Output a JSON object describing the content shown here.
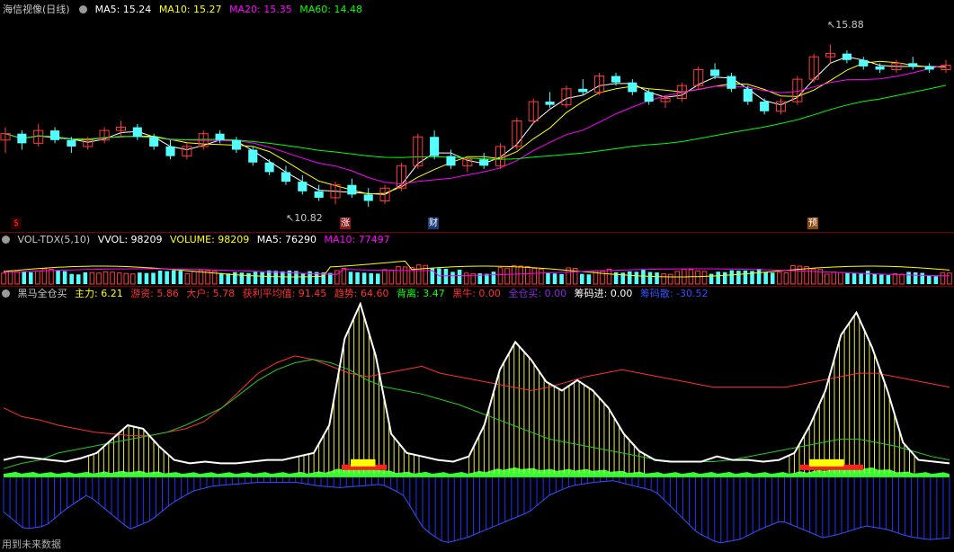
{
  "main": {
    "title": "海信视像(日线)",
    "ma": [
      {
        "label": "MA5: 15.24",
        "color": "#ffffff"
      },
      {
        "label": "MA10: 15.27",
        "color": "#ffff00"
      },
      {
        "label": "MA20: 15.35",
        "color": "#ff00ff"
      },
      {
        "label": "MA60: 14.48",
        "color": "#00ff00"
      }
    ],
    "high_label": "15.88",
    "low_label": "10.82",
    "markers": [
      {
        "text": "$",
        "color": "#ff3030",
        "bg": "#2a0000"
      },
      {
        "text": "涨",
        "color": "#ffffff",
        "bg": "#8a1a1a"
      },
      {
        "text": "财",
        "color": "#ffffff",
        "bg": "#1a3a7a"
      },
      {
        "text": "预",
        "color": "#ffffff",
        "bg": "#8a4a10"
      }
    ]
  },
  "vol": {
    "title": "VOL-TDX(5,10)",
    "items": [
      {
        "label": "VVOL: 98209",
        "color": "#ffffff"
      },
      {
        "label": "VOLUME: 98209",
        "color": "#ffff00"
      },
      {
        "label": "MA5: 76290",
        "color": "#ffffff"
      },
      {
        "label": "MA10: 77497",
        "color": "#ff00ff"
      }
    ]
  },
  "ind": {
    "title": "黑马全仓买",
    "items": [
      {
        "label": "主力: 6.21",
        "color": "#ffff00"
      },
      {
        "label": "游资: 5.86",
        "color": "#ff3030"
      },
      {
        "label": "大户: 5.78",
        "color": "#ff3030"
      },
      {
        "label": "获利平均值: 91.45",
        "color": "#ff3030"
      },
      {
        "label": "趋势: 64.60",
        "color": "#ff3030"
      },
      {
        "label": "背离: 3.47",
        "color": "#00ff00"
      },
      {
        "label": "黑牛: 0.00",
        "color": "#ff3030"
      },
      {
        "label": "全仓买: 0.00",
        "color": "#8a2be2"
      },
      {
        "label": "筹码进: 0.00",
        "color": "#ffffff"
      },
      {
        "label": "筹码散: -30.52",
        "color": "#3050ff"
      }
    ]
  },
  "footer": "用到未来数据",
  "chart_data": [
    {
      "type": "candlestick",
      "title": "海信视像(日线)",
      "series": [
        {
          "name": "MA5",
          "value": 15.24
        },
        {
          "name": "MA10",
          "value": 15.27
        },
        {
          "name": "MA20",
          "value": 15.35
        },
        {
          "name": "MA60",
          "value": 14.48
        }
      ],
      "annotations": [
        {
          "text": "15.88",
          "kind": "high"
        },
        {
          "text": "10.82",
          "kind": "low"
        }
      ],
      "ylim": [
        10.2,
        16.6
      ],
      "ohlc_sample": [
        [
          12.9,
          13.3,
          12.5,
          13.1
        ],
        [
          13.1,
          13.2,
          12.6,
          12.8
        ],
        [
          12.8,
          13.4,
          12.7,
          13.2
        ],
        [
          13.2,
          13.3,
          12.8,
          12.9
        ],
        [
          12.9,
          13.0,
          12.5,
          12.7
        ],
        [
          12.7,
          13.0,
          12.6,
          12.9
        ],
        [
          12.9,
          13.3,
          12.8,
          13.2
        ],
        [
          13.2,
          13.5,
          13.0,
          13.3
        ],
        [
          13.3,
          13.4,
          12.9,
          13.0
        ],
        [
          13.0,
          13.1,
          12.6,
          12.7
        ],
        [
          12.7,
          12.9,
          12.3,
          12.4
        ],
        [
          12.4,
          12.8,
          12.3,
          12.7
        ],
        [
          12.7,
          13.2,
          12.6,
          13.1
        ],
        [
          13.1,
          13.2,
          12.8,
          12.9
        ],
        [
          12.9,
          13.0,
          12.5,
          12.6
        ],
        [
          12.6,
          12.7,
          12.1,
          12.2
        ],
        [
          12.2,
          12.3,
          11.8,
          11.9
        ],
        [
          11.9,
          12.1,
          11.5,
          11.6
        ],
        [
          11.6,
          11.8,
          11.2,
          11.3
        ],
        [
          11.3,
          11.5,
          11.0,
          11.1
        ],
        [
          11.1,
          11.6,
          10.9,
          11.5
        ],
        [
          11.5,
          11.7,
          11.1,
          11.2
        ],
        [
          11.2,
          11.4,
          10.82,
          11.0
        ],
        [
          11.0,
          11.5,
          10.9,
          11.4
        ],
        [
          11.4,
          12.2,
          11.3,
          12.1
        ],
        [
          12.1,
          13.1,
          12.0,
          13.0
        ],
        [
          13.0,
          13.2,
          12.3,
          12.4
        ],
        [
          12.4,
          12.6,
          12.0,
          12.1
        ],
        [
          12.1,
          12.4,
          11.9,
          12.3
        ],
        [
          12.3,
          12.5,
          12.0,
          12.1
        ],
        [
          12.1,
          12.8,
          12.0,
          12.7
        ],
        [
          12.7,
          13.6,
          12.6,
          13.5
        ],
        [
          13.5,
          14.2,
          13.4,
          14.1
        ],
        [
          14.1,
          14.4,
          13.9,
          14.0
        ],
        [
          14.0,
          14.6,
          13.9,
          14.5
        ],
        [
          14.5,
          14.8,
          14.3,
          14.4
        ],
        [
          14.4,
          15.0,
          14.3,
          14.9
        ],
        [
          14.9,
          15.0,
          14.6,
          14.7
        ],
        [
          14.7,
          14.8,
          14.3,
          14.4
        ],
        [
          14.4,
          14.5,
          14.0,
          14.1
        ],
        [
          14.1,
          14.3,
          13.9,
          14.2
        ],
        [
          14.2,
          14.7,
          14.1,
          14.6
        ],
        [
          14.6,
          15.2,
          14.5,
          15.1
        ],
        [
          15.1,
          15.3,
          14.8,
          14.9
        ],
        [
          14.9,
          15.0,
          14.4,
          14.5
        ],
        [
          14.5,
          14.6,
          14.0,
          14.1
        ],
        [
          14.1,
          14.2,
          13.7,
          13.8
        ],
        [
          13.8,
          14.2,
          13.7,
          14.1
        ],
        [
          14.1,
          14.9,
          14.0,
          14.8
        ],
        [
          14.8,
          15.6,
          14.7,
          15.5
        ],
        [
          15.5,
          15.88,
          15.3,
          15.6
        ],
        [
          15.6,
          15.7,
          15.3,
          15.4
        ],
        [
          15.4,
          15.5,
          15.1,
          15.2
        ],
        [
          15.2,
          15.3,
          15.0,
          15.1
        ],
        [
          15.1,
          15.4,
          15.0,
          15.3
        ],
        [
          15.3,
          15.5,
          15.1,
          15.2
        ],
        [
          15.2,
          15.3,
          15.0,
          15.1
        ],
        [
          15.1,
          15.4,
          15.0,
          15.24
        ]
      ]
    },
    {
      "type": "bar",
      "title": "VOL-TDX(5,10)",
      "series": [
        {
          "name": "VVOL",
          "value": 98209
        },
        {
          "name": "VOLUME",
          "value": 98209
        },
        {
          "name": "MA5",
          "value": 76290
        },
        {
          "name": "MA10",
          "value": 77497
        }
      ]
    },
    {
      "type": "line",
      "title": "黑马全仓买",
      "series": [
        {
          "name": "主力",
          "value": 6.21
        },
        {
          "name": "游资",
          "value": 5.86
        },
        {
          "name": "大户",
          "value": 5.78
        },
        {
          "name": "获利平均值",
          "value": 91.45
        },
        {
          "name": "趋势",
          "value": 64.6
        },
        {
          "name": "背离",
          "value": 3.47
        },
        {
          "name": "黑牛",
          "value": 0.0
        },
        {
          "name": "全仓买",
          "value": 0.0
        },
        {
          "name": "筹码进",
          "value": 0.0
        },
        {
          "name": "筹码散",
          "value": -30.52
        }
      ],
      "ylim": [
        -40,
        100
      ],
      "sample": {
        "white": [
          10,
          12,
          11,
          10,
          9,
          11,
          14,
          22,
          30,
          28,
          18,
          10,
          8,
          9,
          8,
          8,
          9,
          10,
          10,
          12,
          14,
          30,
          80,
          100,
          70,
          25,
          14,
          12,
          10,
          9,
          12,
          30,
          62,
          78,
          68,
          55,
          50,
          56,
          50,
          40,
          25,
          15,
          10,
          9,
          9,
          9,
          12,
          10,
          10,
          9,
          10,
          14,
          30,
          50,
          82,
          95,
          75,
          50,
          20,
          10,
          9,
          8
        ],
        "green_mid": [
          5,
          8,
          10,
          14,
          16,
          18,
          20,
          22,
          24,
          26,
          30,
          35,
          40,
          48,
          56,
          62,
          66,
          68,
          66,
          62,
          56,
          52,
          50,
          48,
          45,
          42,
          38,
          34,
          30,
          26,
          22,
          20,
          18,
          16,
          14,
          12,
          10,
          9,
          9,
          9,
          10,
          12,
          14,
          16,
          18,
          20,
          22,
          22,
          20,
          18,
          15,
          12,
          10
        ],
        "red_high": [
          40,
          35,
          33,
          30,
          28,
          26,
          25,
          24,
          24,
          26,
          28,
          32,
          40,
          50,
          60,
          66,
          70,
          68,
          64,
          60,
          58,
          60,
          62,
          64,
          60,
          58,
          56,
          54,
          52,
          50,
          52,
          55,
          58,
          60,
          62,
          60,
          58,
          56,
          54,
          52,
          52,
          52,
          52,
          52,
          54,
          56,
          58,
          60,
          60,
          58,
          56,
          54,
          52
        ],
        "chip_blue": [
          -20,
          -30,
          -28,
          -18,
          -10,
          -20,
          -30,
          -25,
          -15,
          -8,
          -5,
          -4,
          -3,
          -3,
          -3,
          -5,
          -6,
          -5,
          -4,
          -10,
          -30,
          -38,
          -35,
          -30,
          -25,
          -20,
          -10,
          -5,
          -3,
          -2,
          -5,
          -8,
          -20,
          -32,
          -38,
          -36,
          -30,
          -25,
          -30,
          -35,
          -32,
          -28,
          -30,
          -34,
          -36,
          -35
        ]
      }
    }
  ]
}
